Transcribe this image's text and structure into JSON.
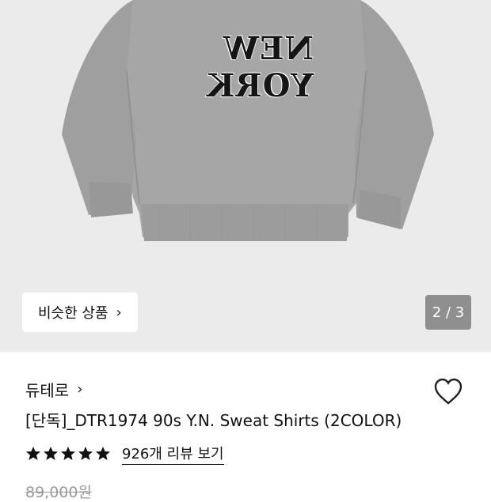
{
  "product": {
    "print_text": "NEW YORK",
    "image_counter": "2 / 3",
    "similar_label": "비슷한 상품",
    "brand": "듀테로",
    "title": "[단독]_DTR1974 90s Y.N. Sweat Shirts (2COLOR)",
    "rating": 5,
    "rating_max": 5,
    "review_link": "926개 리뷰 보기",
    "original_price": "89,000원"
  },
  "icons": {
    "chevron": "chevron-right-icon",
    "heart": "heart-icon",
    "star": "star-icon"
  },
  "colors": {
    "hero_bg": "#ebebeb",
    "sweatshirt": "#a6a6a6",
    "counter_bg": "#8f8f8f"
  }
}
